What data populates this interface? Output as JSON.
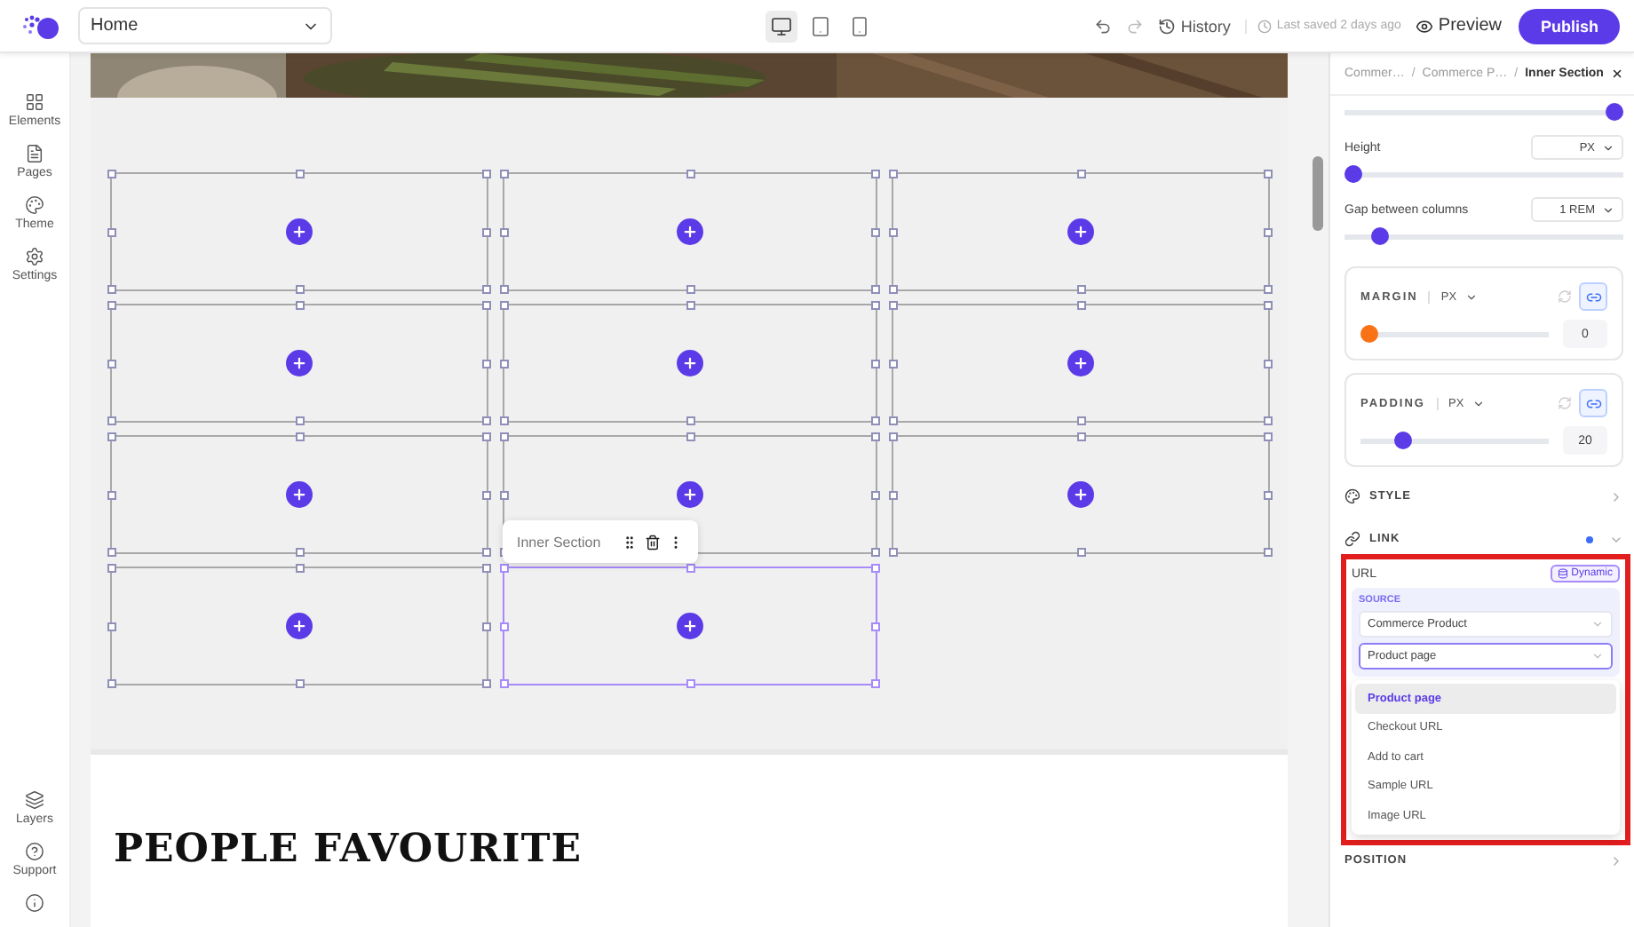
{
  "topbar": {
    "page_select": "Home",
    "devices": [
      {
        "kind": "desktop",
        "selected": true
      },
      {
        "kind": "tablet",
        "selected": false
      },
      {
        "kind": "mobile",
        "selected": false
      }
    ],
    "history": "History",
    "last_saved": "Last saved 2 days ago",
    "preview": "Preview",
    "publish": "Publish"
  },
  "sidebar": {
    "items": [
      {
        "kind": "elements",
        "label": "Elements"
      },
      {
        "kind": "pages",
        "label": "Pages"
      },
      {
        "kind": "theme",
        "label": "Theme"
      },
      {
        "kind": "settings",
        "label": "Settings"
      }
    ],
    "bottom_items": [
      {
        "kind": "layers",
        "label": "Layers"
      },
      {
        "kind": "support",
        "label": "Support"
      },
      {
        "kind": "info"
      }
    ]
  },
  "canvas": {
    "cells": [
      {
        "selected": false
      },
      {
        "selected": false
      },
      {
        "selected": false
      },
      {
        "selected": false
      },
      {
        "selected": false
      },
      {
        "selected": false
      },
      {
        "selected": false
      },
      {
        "selected": false
      },
      {
        "selected": false
      },
      {
        "selected": false
      },
      {
        "selected": true
      }
    ],
    "toolbar": {
      "label": "Inner Section"
    },
    "heading": "PEOPLE FAVOURITE"
  },
  "panel": {
    "breadcrumb": [
      "Commer…",
      "Commerce P…",
      "Inner Section"
    ],
    "breadcrumb_separator": "/",
    "sliders": [
      {
        "level": 1
      },
      {
        "label": "Height",
        "unit": "PX",
        "level": 0
      },
      {
        "label": "Gap between columns",
        "unit": "1 REM",
        "level": 0.1
      }
    ],
    "spacing": [
      {
        "label": "MARGIN",
        "unit": "PX",
        "level": 0,
        "value": "0",
        "color": "#f97316",
        "linked": true
      },
      {
        "label": "PADDING",
        "unit": "PX",
        "level": 0.2,
        "value": "20",
        "color": "#5b3be8",
        "linked": true
      }
    ],
    "style": {
      "label": "STYLE"
    },
    "link": {
      "label": "LINK",
      "modified": true,
      "url_label": "URL",
      "dynamic": "Dynamic",
      "source_label": "SOURCE",
      "source": "Commerce Product",
      "field": "Product page",
      "options": [
        {
          "label": "Product page",
          "selected": true
        },
        {
          "label": "Checkout URL",
          "selected": false
        },
        {
          "label": "Add to cart",
          "selected": false
        },
        {
          "label": "Sample URL",
          "selected": false
        },
        {
          "label": "Image URL",
          "selected": false
        }
      ]
    },
    "position": {
      "label": "POSITION"
    }
  }
}
